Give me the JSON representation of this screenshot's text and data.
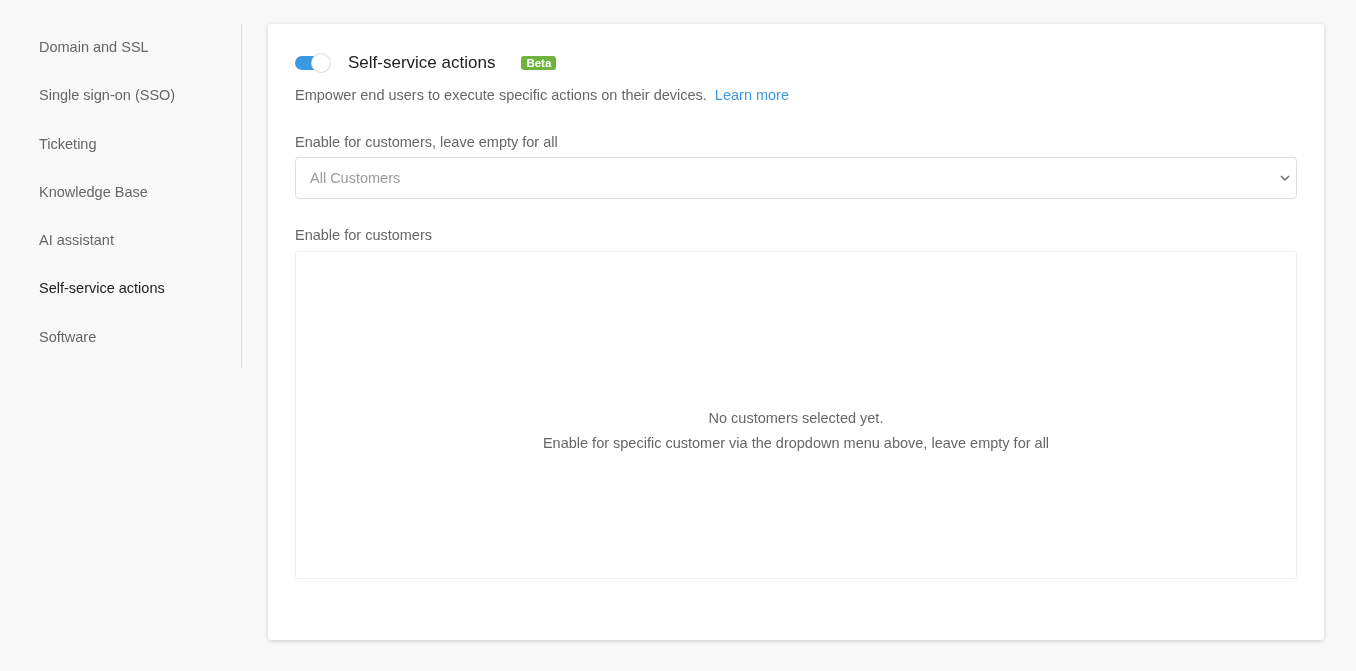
{
  "sidebar": {
    "items": [
      {
        "label": "Domain and SSL",
        "selected": false
      },
      {
        "label": "Single sign-on (SSO)",
        "selected": false
      },
      {
        "label": "Ticketing",
        "selected": false
      },
      {
        "label": "Knowledge Base",
        "selected": false
      },
      {
        "label": "AI assistant",
        "selected": false
      },
      {
        "label": "Self-service actions",
        "selected": true
      },
      {
        "label": "Software",
        "selected": false
      }
    ]
  },
  "panel": {
    "toggle": {
      "on": true
    },
    "title": "Self-service actions",
    "badge": "Beta",
    "description": "Empower end users to execute specific actions on their devices.",
    "link": "Learn more",
    "select_label": "Enable for customers, leave empty for all",
    "select": {
      "placeholder": "All Customers"
    },
    "list_label": "Enable for customers",
    "empty_title": "No customers selected yet.",
    "empty_text": "Enable for specific customer via the dropdown menu above, leave empty for all"
  }
}
